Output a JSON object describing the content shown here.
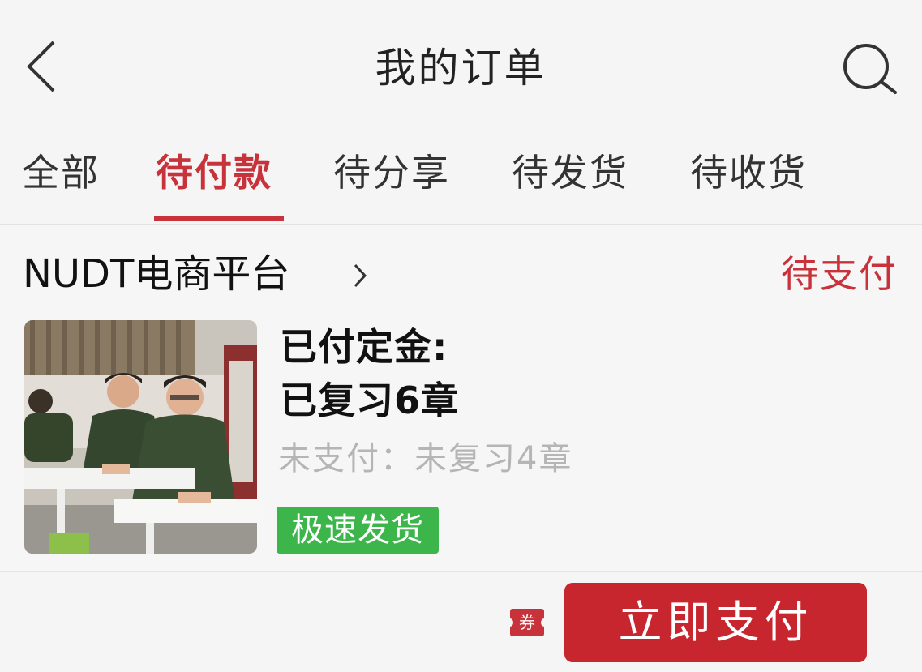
{
  "header": {
    "title": "我的订单",
    "back_icon": "chevron-left-icon",
    "search_icon": "search-icon"
  },
  "tabs": [
    {
      "label": "全部",
      "active": false
    },
    {
      "label": "待付款",
      "active": true
    },
    {
      "label": "待分享",
      "active": false
    },
    {
      "label": "待发货",
      "active": false
    },
    {
      "label": "待收货",
      "active": false
    }
  ],
  "order": {
    "store_name": "NUDT电商平台",
    "status": "待支付",
    "item_line1": "已付定金:",
    "item_line2": "已复习6章",
    "item_sub": "未支付：未复习4章",
    "badge": "极速发货"
  },
  "footer": {
    "coupon_label": "券",
    "pay_button": "立即支付"
  },
  "colors": {
    "accent": "#c8323a",
    "pay_button": "#c8262e",
    "badge_green": "#3cb64a",
    "muted_text": "#b5b5b5"
  }
}
